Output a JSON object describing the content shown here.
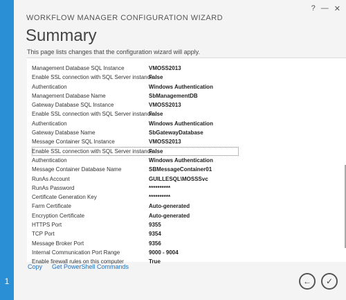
{
  "step_number": "1",
  "window_controls": {
    "help": "?",
    "minimize": "—",
    "close": "✕"
  },
  "wizard_title": "WORKFLOW MANAGER CONFIGURATION WIZARD",
  "page_title": "Summary",
  "page_desc": "This page lists changes that the configuration wizard will apply.",
  "rows": [
    {
      "key": "Management Database SQL Instance",
      "value": "VMOSS2013"
    },
    {
      "key": "Enable SSL connection with SQL Server instance",
      "value": "False"
    },
    {
      "key": "Authentication",
      "value": "Windows Authentication"
    },
    {
      "key": "Management Database Name",
      "value": "SbManagementDB"
    },
    {
      "key": "Gateway Database SQL Instance",
      "value": "VMOSS2013"
    },
    {
      "key": "Enable SSL connection with SQL Server instance",
      "value": "False"
    },
    {
      "key": "Authentication",
      "value": "Windows Authentication"
    },
    {
      "key": "Gateway Database Name",
      "value": "SbGatewayDatabase"
    },
    {
      "key": "Message Container SQL Instance",
      "value": "VMOSS2013"
    },
    {
      "key": "Enable SSL connection with SQL Server instance",
      "value": "False"
    },
    {
      "key": "Authentication",
      "value": "Windows Authentication"
    },
    {
      "key": "Message Container Database Name",
      "value": "SBMessageContainer01"
    },
    {
      "key": "RunAs Account",
      "value": "GUILLESQL\\MOSSSvc"
    },
    {
      "key": "RunAs Password",
      "value": "**********"
    },
    {
      "key": "Certificate Generation Key",
      "value": "**********"
    },
    {
      "key": "Farm Certificate",
      "value": "Auto-generated"
    },
    {
      "key": "Encryption Certificate",
      "value": "Auto-generated"
    },
    {
      "key": "HTTPS Port",
      "value": "9355"
    },
    {
      "key": "TCP Port",
      "value": "9354"
    },
    {
      "key": "Message Broker Port",
      "value": "9356"
    },
    {
      "key": "Internal Communication Port Range",
      "value": "9000 - 9004"
    },
    {
      "key": "Enable firewall rules on this computer",
      "value": "True"
    }
  ],
  "links": {
    "copy": "Copy",
    "powershell": "Get PowerShell Commands"
  },
  "nav": {
    "back_glyph": "←",
    "apply_glyph": "✓"
  }
}
